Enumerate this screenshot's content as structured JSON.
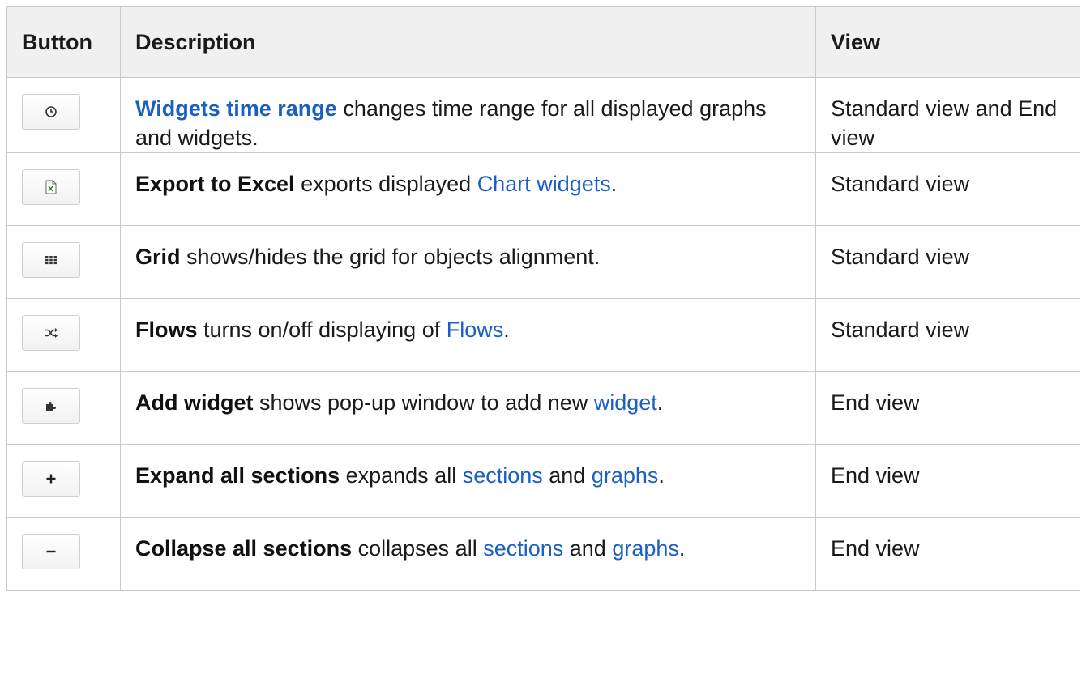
{
  "headers": {
    "button": "Button",
    "description": "Description",
    "view": "View"
  },
  "rows": [
    {
      "icon": "clock-icon",
      "term": "Widgets time range",
      "term_is_link": true,
      "desc_a": " changes time range for all displayed graphs and widgets.",
      "link1": "",
      "mid": "",
      "link2": "",
      "tail": "",
      "view": "Standard view and End view"
    },
    {
      "icon": "excel-icon",
      "term": "Export to Excel",
      "term_is_link": false,
      "desc_a": " exports displayed ",
      "link1": "Chart widgets",
      "mid": "",
      "link2": "",
      "tail": ".",
      "view": "Standard view"
    },
    {
      "icon": "grid-icon",
      "term": "Grid",
      "term_is_link": false,
      "desc_a": " shows/hides the grid for objects alignment.",
      "link1": "",
      "mid": "",
      "link2": "",
      "tail": "",
      "view": "Standard view"
    },
    {
      "icon": "shuffle-icon",
      "term": "Flows",
      "term_is_link": false,
      "desc_a": " turns on/off displaying of ",
      "link1": "Flows",
      "mid": "",
      "link2": "",
      "tail": ".",
      "view": "Standard view"
    },
    {
      "icon": "puzzle-icon",
      "term": "Add widget",
      "term_is_link": false,
      "desc_a": " shows pop-up window to add new ",
      "link1": "widget",
      "mid": "",
      "link2": "",
      "tail": ".",
      "view": "End view"
    },
    {
      "icon": "plus-icon",
      "term": "Expand all sections",
      "term_is_link": false,
      "desc_a": " expands all ",
      "link1": "sections",
      "mid": " and ",
      "link2": "graphs",
      "tail": ".",
      "view": "End view"
    },
    {
      "icon": "minus-icon",
      "term": "Collapse all sections",
      "term_is_link": false,
      "desc_a": " collapses all ",
      "link1": "sections",
      "mid": " and ",
      "link2": "graphs",
      "tail": ".",
      "view": "End view"
    }
  ],
  "colors": {
    "link": "#1b5fc4",
    "header_bg": "#f0f0f0",
    "border": "#c9c9c9"
  }
}
